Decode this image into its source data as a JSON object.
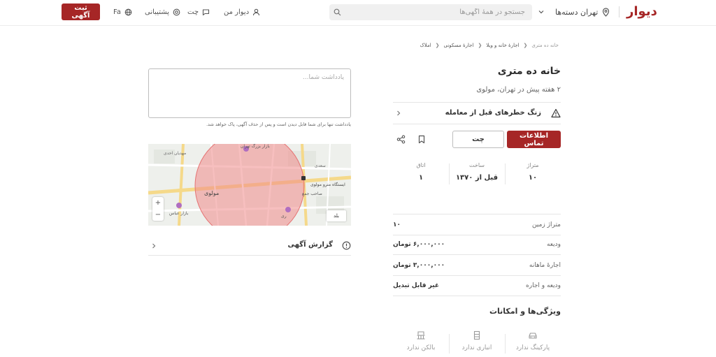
{
  "header": {
    "logo": "دیوار",
    "city": "تهران",
    "categories": "دسته‌ها",
    "search_placeholder": "جستجو در همهٔ آگهی‌ها",
    "my_divar": "دیوار من",
    "chat": "چت",
    "support": "پشتیبانی",
    "lang": "Fa",
    "post_ad": "ثبت آگهی"
  },
  "breadcrumb": [
    "املاک",
    "اجارهٔ مسکونی",
    "اجارهٔ خانه و ویلا",
    "خانه ده متری"
  ],
  "listing": {
    "title": "خانه ده متری",
    "subtitle": "۲ هفته پیش در تهران، مولوی",
    "warning": "زنگ خطرهای قبل از معامله",
    "contact_button": "اطلاعات تماس",
    "chat_button": "چت",
    "stats": [
      {
        "label": "متراژ",
        "value": "۱۰"
      },
      {
        "label": "ساخت",
        "value": "قبل از ۱۳۷۰"
      },
      {
        "label": "اتاق",
        "value": "۱"
      }
    ],
    "details": [
      {
        "key": "متراژ زمین",
        "value": "۱۰"
      },
      {
        "key": "ودیعه",
        "value": "۶,۰۰۰,۰۰۰ تومان"
      },
      {
        "key": "اجارهٔ ماهانه",
        "value": "۳,۰۰۰,۰۰۰ تومان"
      },
      {
        "key": "ودیعه و اجاره",
        "value": "غیر قابل تبدیل"
      }
    ],
    "features_title": "ویژگی‌ها و امکانات",
    "features": [
      {
        "label": "پارکینگ ندارد",
        "icon": "car-icon"
      },
      {
        "label": "انباری ندارد",
        "icon": "storage-icon"
      },
      {
        "label": "بالکن ندارد",
        "icon": "balcony-icon"
      }
    ]
  },
  "notes": {
    "placeholder": "یادداشت شما...",
    "hint": "یادداشت تنها برای شما قابل دیدن است و پس از حذف آگهی، پاک خواهد شد."
  },
  "map": {
    "labels": [
      "بازار بزرگ تهران",
      "مهدیان احدی",
      "سعدی",
      "مولوی",
      "ایستگاه مترو مولوی",
      "صاحب جمع",
      "بازار عباس",
      "ری"
    ],
    "logo_text": "بلد",
    "zoom_in": "+",
    "zoom_out": "−"
  },
  "report": "گزارش آگهی",
  "colors": {
    "brand": "#a62626",
    "map_circle": "#f08a8a",
    "map_bg": "#eef0ec"
  }
}
